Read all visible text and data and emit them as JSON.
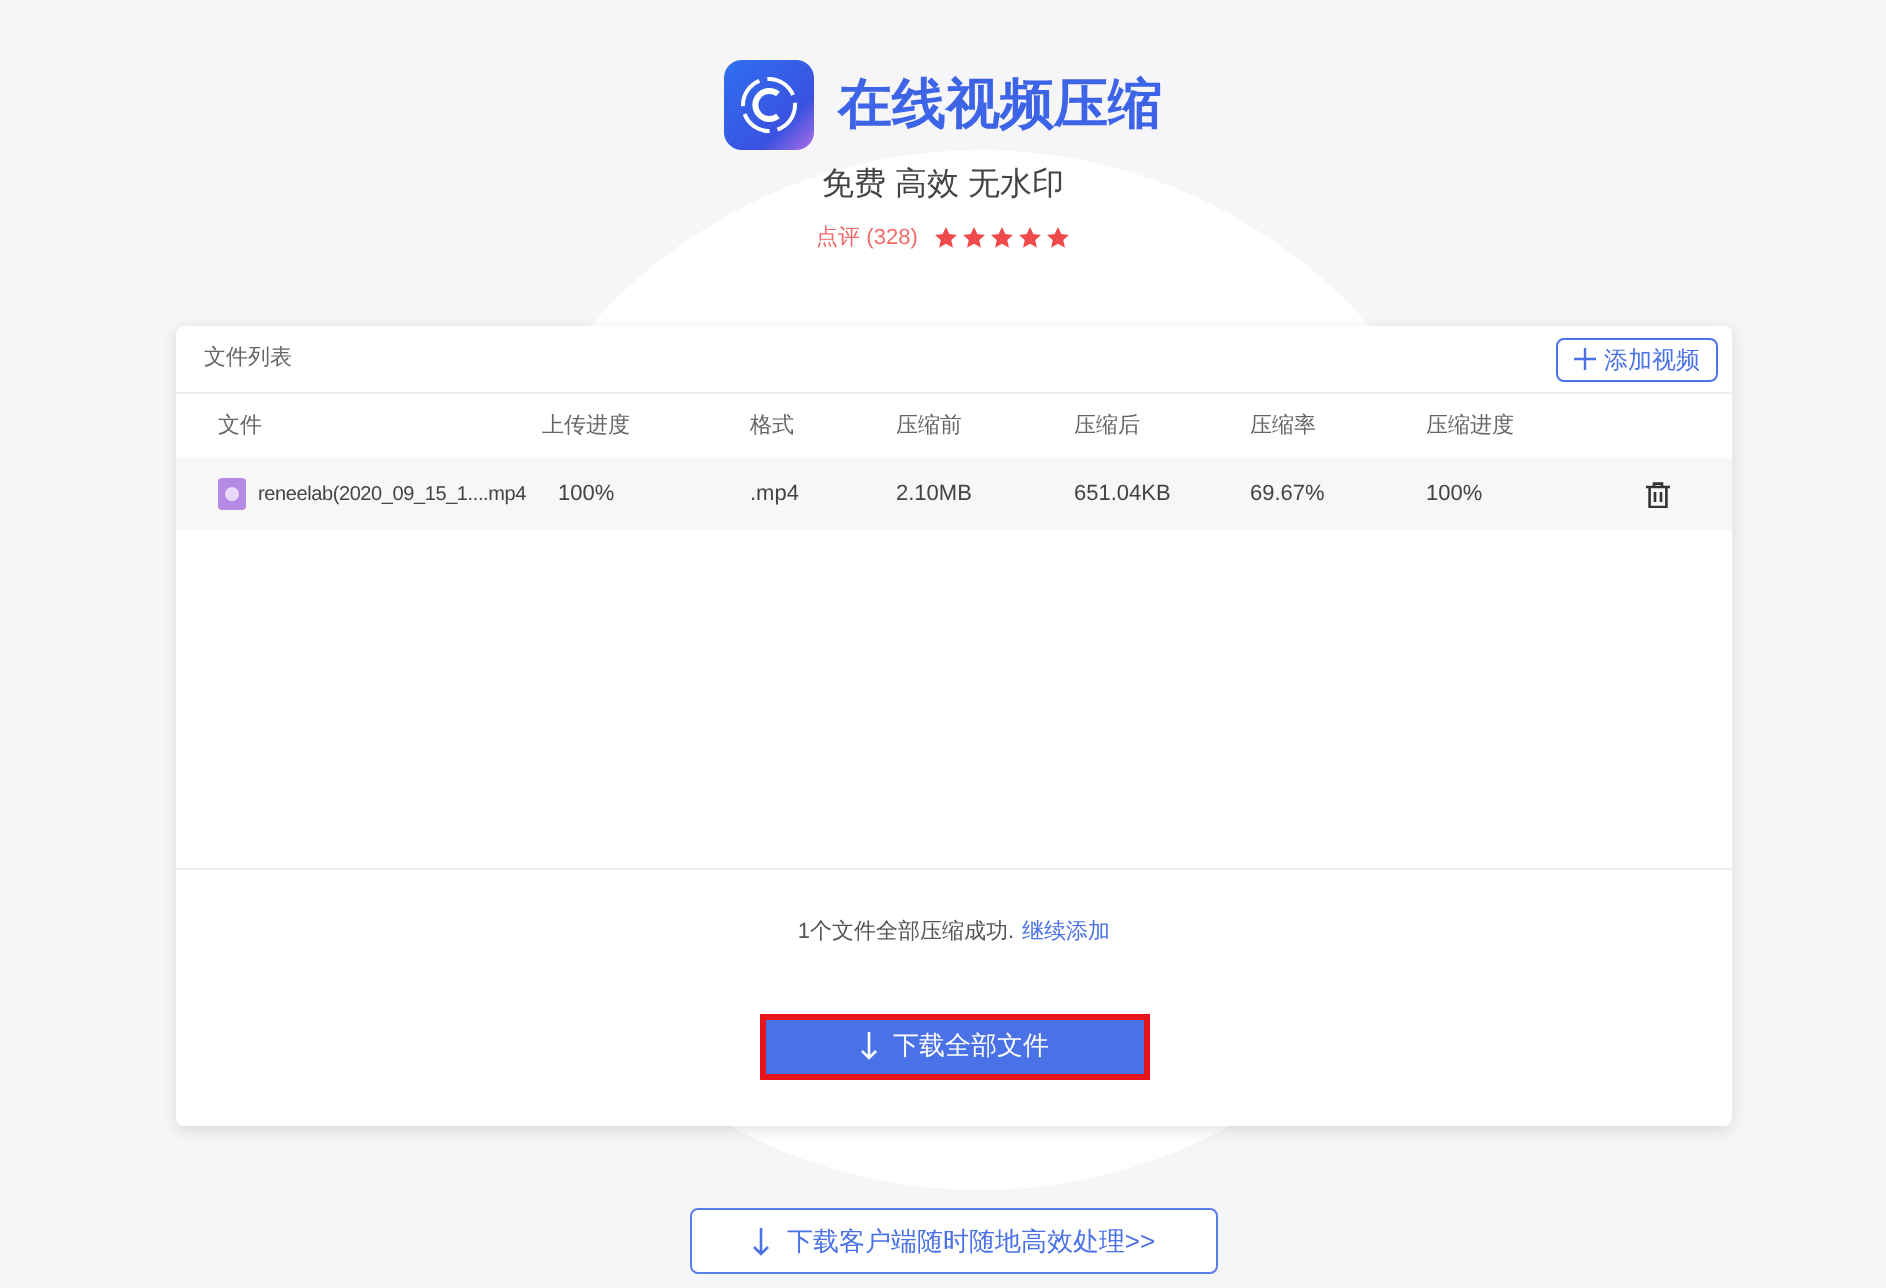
{
  "header": {
    "title": "在线视频压缩",
    "subtitle": "免费 高效 无水印",
    "rating_label": "点评 (328)",
    "stars": 5
  },
  "file_list": {
    "title": "文件列表",
    "add_button": "添加视频",
    "columns": [
      "文件",
      "上传进度",
      "格式",
      "压缩前",
      "压缩后",
      "压缩率",
      "压缩进度"
    ],
    "rows": [
      {
        "file": "reneelab(2020_09_15_1....mp4",
        "upload": "100%",
        "format": ".mp4",
        "before": "2.10MB",
        "after": "651.04KB",
        "ratio": "69.67%",
        "progress": "100%"
      }
    ],
    "status_text": "1个文件全部压缩成功.",
    "continue_link": "继续添加",
    "download_all": "下载全部文件"
  },
  "client_button": "下载客户端随时随地高效处理>>"
}
